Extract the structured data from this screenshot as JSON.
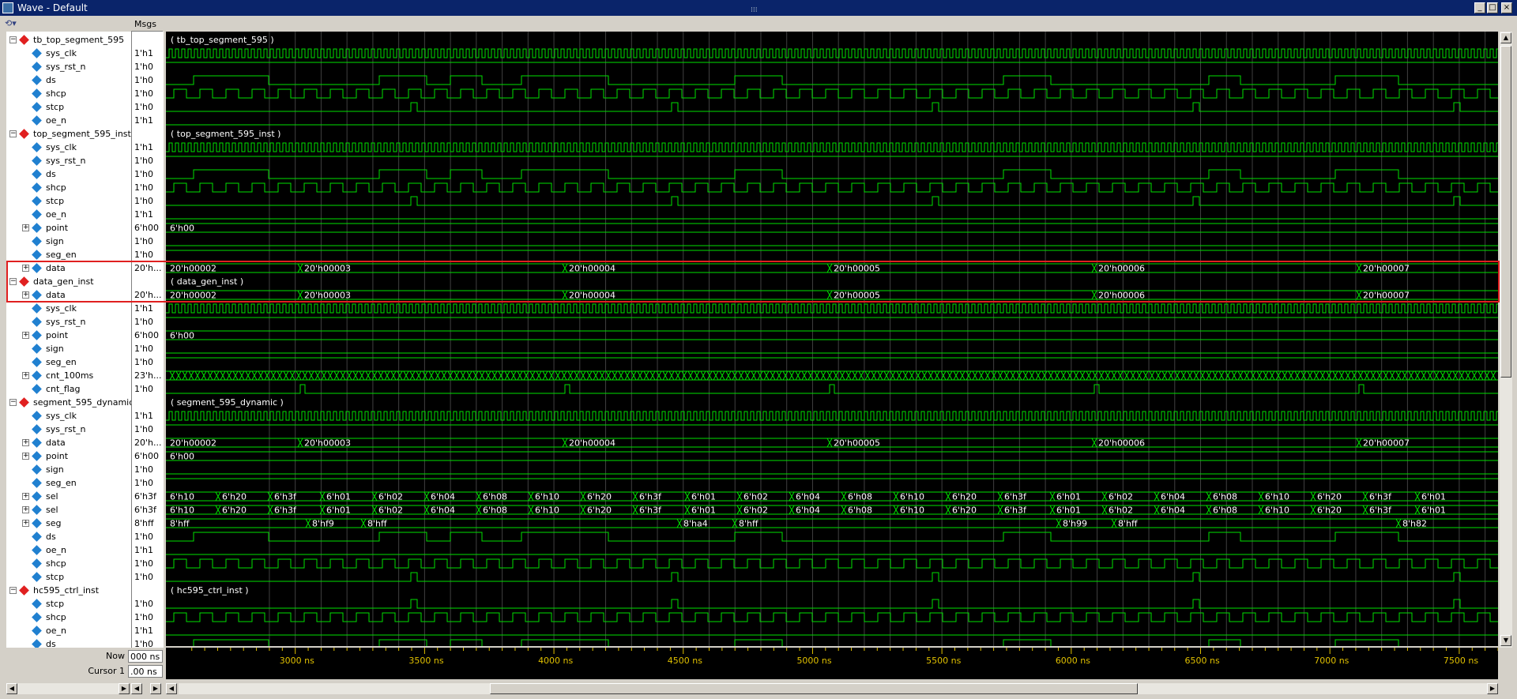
{
  "window": {
    "title": "Wave - Default",
    "grip": "⁞⁞⁞",
    "buttons": [
      "_",
      "□",
      "×",
      "_",
      "□",
      "×"
    ]
  },
  "toolbar": {
    "tool_glyph": "⟲▾"
  },
  "columns": {
    "msgs": "Msgs"
  },
  "signals": [
    {
      "name": "tb_top_segment_595",
      "value": "",
      "kind": "group",
      "indent": 0,
      "expand": "−"
    },
    {
      "name": "sys_clk",
      "value": "1'h1",
      "kind": "sig",
      "indent": 1,
      "expand": ""
    },
    {
      "name": "sys_rst_n",
      "value": "1'h0",
      "kind": "sig",
      "indent": 1,
      "expand": ""
    },
    {
      "name": "ds",
      "value": "1'h0",
      "kind": "sig",
      "indent": 1,
      "expand": ""
    },
    {
      "name": "shcp",
      "value": "1'h0",
      "kind": "sig",
      "indent": 1,
      "expand": ""
    },
    {
      "name": "stcp",
      "value": "1'h0",
      "kind": "sig",
      "indent": 1,
      "expand": ""
    },
    {
      "name": "oe_n",
      "value": "1'h1",
      "kind": "sig",
      "indent": 1,
      "expand": ""
    },
    {
      "name": "top_segment_595_inst",
      "value": "",
      "kind": "group",
      "indent": 0,
      "expand": "−"
    },
    {
      "name": "sys_clk",
      "value": "1'h1",
      "kind": "sig",
      "indent": 1,
      "expand": ""
    },
    {
      "name": "sys_rst_n",
      "value": "1'h0",
      "kind": "sig",
      "indent": 1,
      "expand": ""
    },
    {
      "name": "ds",
      "value": "1'h0",
      "kind": "sig",
      "indent": 1,
      "expand": ""
    },
    {
      "name": "shcp",
      "value": "1'h0",
      "kind": "sig",
      "indent": 1,
      "expand": ""
    },
    {
      "name": "stcp",
      "value": "1'h0",
      "kind": "sig",
      "indent": 1,
      "expand": ""
    },
    {
      "name": "oe_n",
      "value": "1'h1",
      "kind": "sig",
      "indent": 1,
      "expand": ""
    },
    {
      "name": "point",
      "value": "6'h00",
      "kind": "sig",
      "indent": 1,
      "expand": "+"
    },
    {
      "name": "sign",
      "value": "1'h0",
      "kind": "sig",
      "indent": 1,
      "expand": ""
    },
    {
      "name": "seg_en",
      "value": "1'h0",
      "kind": "sig",
      "indent": 1,
      "expand": ""
    },
    {
      "name": "data",
      "value": "20'h...",
      "kind": "sig",
      "indent": 1,
      "expand": "+"
    },
    {
      "name": "data_gen_inst",
      "value": "",
      "kind": "group",
      "indent": 0,
      "expand": "−"
    },
    {
      "name": "data",
      "value": "20'h...",
      "kind": "sig",
      "indent": 1,
      "expand": "+"
    },
    {
      "name": "sys_clk",
      "value": "1'h1",
      "kind": "sig",
      "indent": 1,
      "expand": ""
    },
    {
      "name": "sys_rst_n",
      "value": "1'h0",
      "kind": "sig",
      "indent": 1,
      "expand": ""
    },
    {
      "name": "point",
      "value": "6'h00",
      "kind": "sig",
      "indent": 1,
      "expand": "+"
    },
    {
      "name": "sign",
      "value": "1'h0",
      "kind": "sig",
      "indent": 1,
      "expand": ""
    },
    {
      "name": "seg_en",
      "value": "1'h0",
      "kind": "sig",
      "indent": 1,
      "expand": ""
    },
    {
      "name": "cnt_100ms",
      "value": "23'h...",
      "kind": "sig",
      "indent": 1,
      "expand": "+"
    },
    {
      "name": "cnt_flag",
      "value": "1'h0",
      "kind": "sig",
      "indent": 1,
      "expand": ""
    },
    {
      "name": "segment_595_dynamic",
      "value": "",
      "kind": "group",
      "indent": 0,
      "expand": "−"
    },
    {
      "name": "sys_clk",
      "value": "1'h1",
      "kind": "sig",
      "indent": 1,
      "expand": ""
    },
    {
      "name": "sys_rst_n",
      "value": "1'h0",
      "kind": "sig",
      "indent": 1,
      "expand": ""
    },
    {
      "name": "data",
      "value": "20'h...",
      "kind": "sig",
      "indent": 1,
      "expand": "+"
    },
    {
      "name": "point",
      "value": "6'h00",
      "kind": "sig",
      "indent": 1,
      "expand": "+"
    },
    {
      "name": "sign",
      "value": "1'h0",
      "kind": "sig",
      "indent": 1,
      "expand": ""
    },
    {
      "name": "seg_en",
      "value": "1'h0",
      "kind": "sig",
      "indent": 1,
      "expand": ""
    },
    {
      "name": "sel",
      "value": "6'h3f",
      "kind": "sig",
      "indent": 1,
      "expand": "+"
    },
    {
      "name": "sel",
      "value": "6'h3f",
      "kind": "sig",
      "indent": 1,
      "expand": "+"
    },
    {
      "name": "seg",
      "value": "8'hff",
      "kind": "sig",
      "indent": 1,
      "expand": "+"
    },
    {
      "name": "ds",
      "value": "1'h0",
      "kind": "sig",
      "indent": 1,
      "expand": ""
    },
    {
      "name": "oe_n",
      "value": "1'h1",
      "kind": "sig",
      "indent": 1,
      "expand": ""
    },
    {
      "name": "shcp",
      "value": "1'h0",
      "kind": "sig",
      "indent": 1,
      "expand": ""
    },
    {
      "name": "stcp",
      "value": "1'h0",
      "kind": "sig",
      "indent": 1,
      "expand": ""
    },
    {
      "name": "hc595_ctrl_inst",
      "value": "",
      "kind": "group",
      "indent": 0,
      "expand": "−"
    },
    {
      "name": "stcp",
      "value": "1'h0",
      "kind": "sig",
      "indent": 1,
      "expand": ""
    },
    {
      "name": "shcp",
      "value": "1'h0",
      "kind": "sig",
      "indent": 1,
      "expand": ""
    },
    {
      "name": "oe_n",
      "value": "1'h1",
      "kind": "sig",
      "indent": 1,
      "expand": ""
    },
    {
      "name": "ds",
      "value": "1'h0",
      "kind": "sig",
      "indent": 1,
      "expand": ""
    }
  ],
  "waves": {
    "instance_labels": [
      "( tb_top_segment_595 )",
      "( top_segment_595_inst )",
      "( data_gen_inst )",
      "( segment_595_dynamic )",
      "( hc595_ctrl_inst )"
    ],
    "data_values": [
      "20'h00002",
      "20'h00003",
      "20'h00004",
      "20'h00005",
      "20'h00006",
      "20'h00007"
    ],
    "point_value": "6'h00",
    "sel_values": [
      "6'h10",
      "6'h20",
      "6'h3f",
      "6'h01",
      "6'h02",
      "6'h04",
      "6'h08",
      "6'h10",
      "6'h20",
      "6'h3f",
      "6'h01",
      "6'h02",
      "6'h04",
      "6'h08",
      "6'h10",
      "6'h20",
      "6'h3f",
      "6'h01",
      "6'h02",
      "6'h04",
      "6'h08",
      "6'h10",
      "6'h20",
      "6'h3f",
      "6'h01"
    ],
    "seg_values": [
      "8'hff",
      "8'hf9",
      "8'hff",
      "8'ha4",
      "8'hff",
      "8'h99",
      "8'hff",
      "8'h82"
    ]
  },
  "timeline": {
    "ticks": [
      "3000 ns",
      "3500 ns",
      "4000 ns",
      "4500 ns",
      "5000 ns",
      "5500 ns",
      "6000 ns",
      "6500 ns",
      "7000 ns",
      "7500 ns"
    ]
  },
  "bottom": {
    "now_label": "Now",
    "now_value": "000 ns",
    "cursor_label": "Cursor 1",
    "cursor_value": ".00 ns"
  },
  "colors": {
    "wave": "#00e000",
    "background": "#000000",
    "grid": "#404040",
    "highlight": "#e02020",
    "ruler": "#e0c000"
  }
}
